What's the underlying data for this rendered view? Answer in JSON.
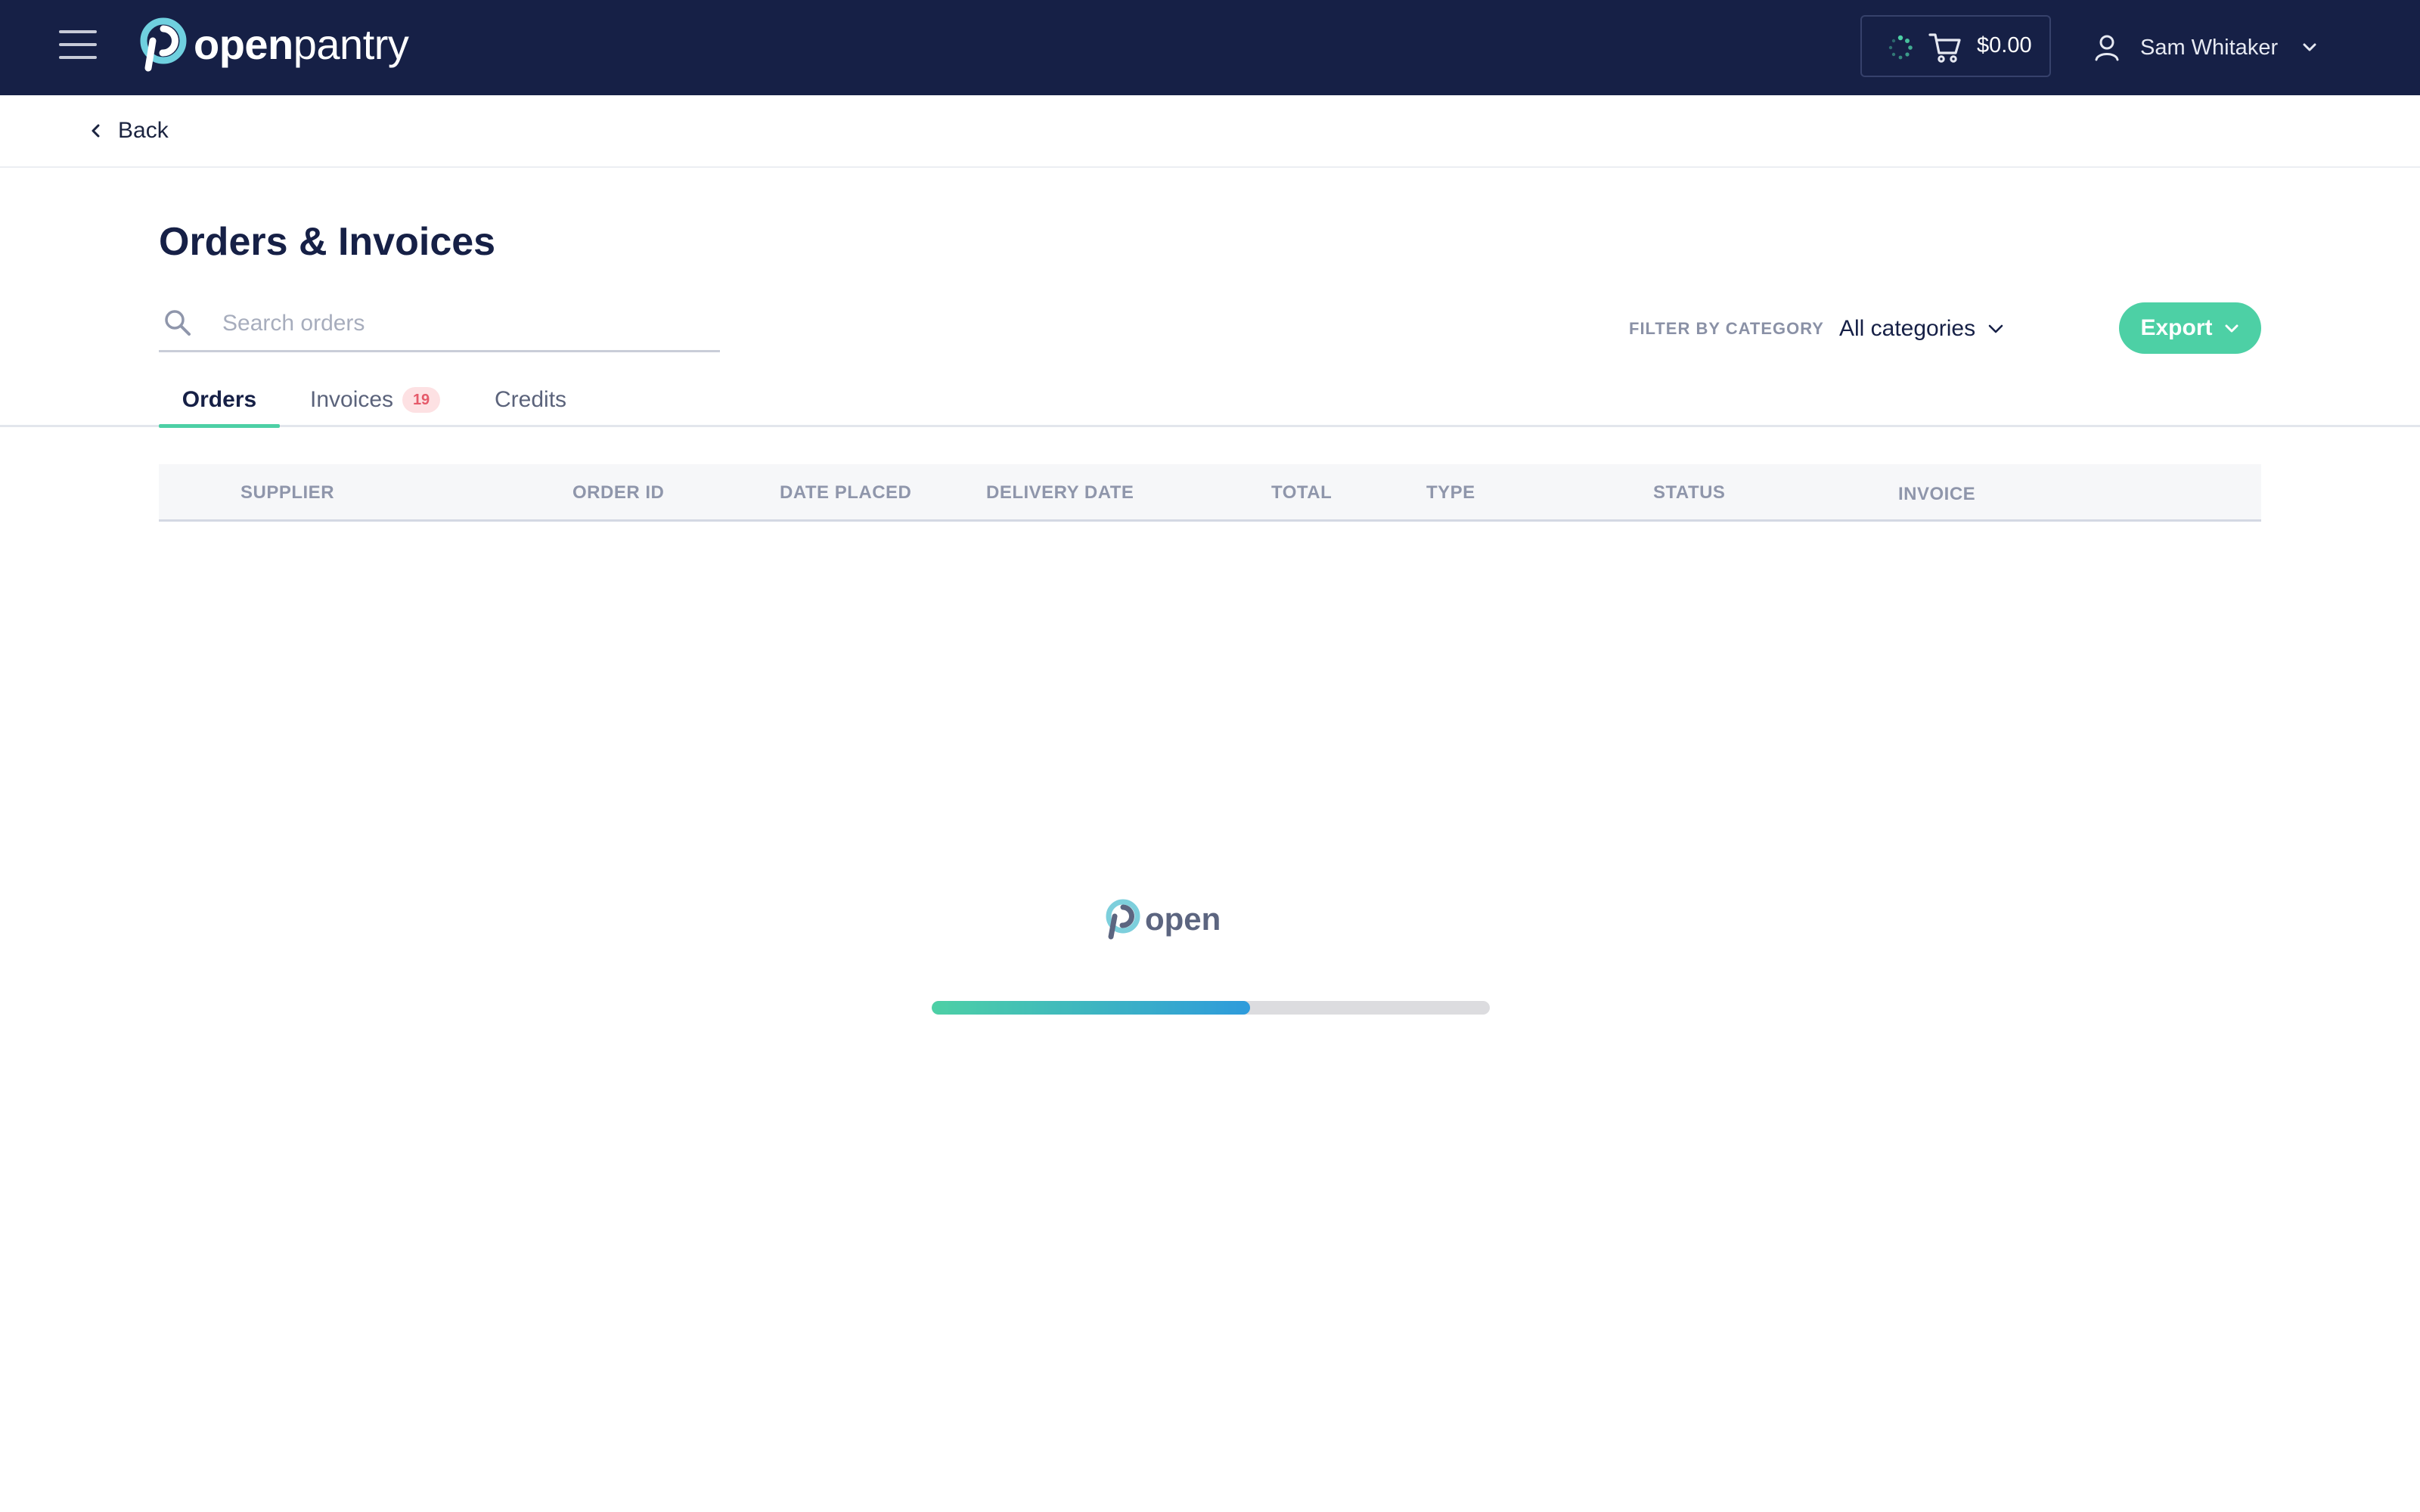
{
  "app": {
    "logo_text_bold": "open",
    "logo_text_light": "pantry"
  },
  "cart": {
    "amount": "$0.00"
  },
  "user": {
    "name": "Sam Whitaker"
  },
  "nav": {
    "back_label": "Back"
  },
  "page": {
    "title": "Orders & Invoices"
  },
  "search": {
    "placeholder": "Search orders",
    "value": ""
  },
  "filter": {
    "label": "FILTER BY CATEGORY",
    "value": "All categories"
  },
  "export": {
    "label": "Export"
  },
  "tabs": [
    {
      "label": "Orders",
      "active": true
    },
    {
      "label": "Invoices",
      "badge": "19",
      "active": false
    },
    {
      "label": "Credits",
      "active": false
    }
  ],
  "table": {
    "columns": [
      "SUPPLIER",
      "ORDER ID",
      "DATE PLACED",
      "DELIVERY DATE",
      "TOTAL",
      "TYPE",
      "STATUS",
      "INVOICE"
    ]
  },
  "loader": {
    "logo_text": "open",
    "progress": 0.57
  },
  "colors": {
    "topbar": "#162046",
    "accent": "#4dd0a5",
    "progress_end": "#2e9bdc",
    "badge_bg": "#fde1e3",
    "badge_text": "#e55a6a"
  },
  "icons": [
    "menu-icon",
    "logo-mark-icon",
    "spinner-icon",
    "cart-icon",
    "user-icon",
    "chevron-down-icon",
    "chevron-left-icon",
    "search-icon"
  ]
}
